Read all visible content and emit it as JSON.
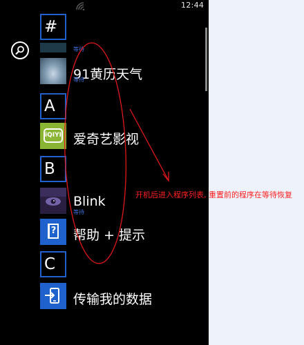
{
  "status_bar": {
    "time": "12:44",
    "signal_icon": "signal-icon"
  },
  "search": {
    "icon": "search-icon"
  },
  "app_list": {
    "groups": [
      {
        "letter": "#"
      },
      {
        "letter": "A"
      },
      {
        "letter": "B"
      },
      {
        "letter": "C"
      }
    ],
    "apps": [
      {
        "name": "",
        "status": "等待",
        "icon": "partial-app-icon"
      },
      {
        "name": "91黄历天气",
        "status": "等待",
        "icon": "calendar-weather-icon"
      },
      {
        "name": "爱奇艺影视",
        "status": "",
        "icon": "iqiyi-icon",
        "badge": "iQIYI",
        "tile_color": "#8ab534"
      },
      {
        "name": "Blink",
        "status": "等待",
        "icon": "eye-icon"
      },
      {
        "name": "帮助 + 提示",
        "status": "",
        "icon": "help-icon",
        "tile_color": "#1f62ce"
      },
      {
        "name": "传输我的数据",
        "status": "",
        "icon": "transfer-icon",
        "tile_color": "#1f62ce"
      }
    ]
  },
  "annotation": {
    "text": "开机后进入程序列表, 重置前的程序在等待恢复",
    "color": "#ff2020"
  }
}
